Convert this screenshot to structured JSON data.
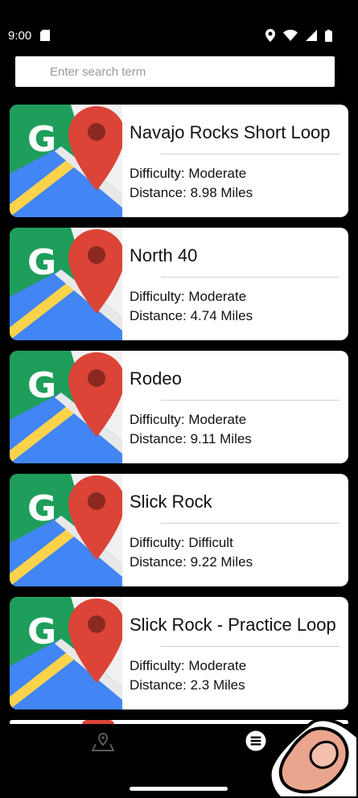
{
  "status": {
    "time": "9:00"
  },
  "search": {
    "placeholder": "Enter search term"
  },
  "trails": [
    {
      "name": "Navajo Rocks Short Loop",
      "difficulty": "Difficulty: Moderate",
      "distance": "Distance: 8.98 Miles"
    },
    {
      "name": "North 40",
      "difficulty": "Difficulty: Moderate",
      "distance": "Distance: 4.74 Miles"
    },
    {
      "name": "Rodeo",
      "difficulty": "Difficulty: Moderate",
      "distance": "Distance: 9.11 Miles"
    },
    {
      "name": "Slick Rock",
      "difficulty": "Difficulty: Difficult",
      "distance": "Distance: 9.22 Miles"
    },
    {
      "name": "Slick Rock - Practice Loop",
      "difficulty": "Difficulty: Moderate",
      "distance": "Distance: 2.3 Miles"
    }
  ],
  "bottom_nav": {
    "items": [
      "map-pin-icon",
      "list-icon"
    ]
  },
  "colors": {
    "background": "#000000",
    "card": "#ffffff",
    "pin": "#db4437",
    "map_green": "#1e9e5a",
    "map_blue": "#4285f4",
    "map_yellow": "#fbd34b"
  }
}
